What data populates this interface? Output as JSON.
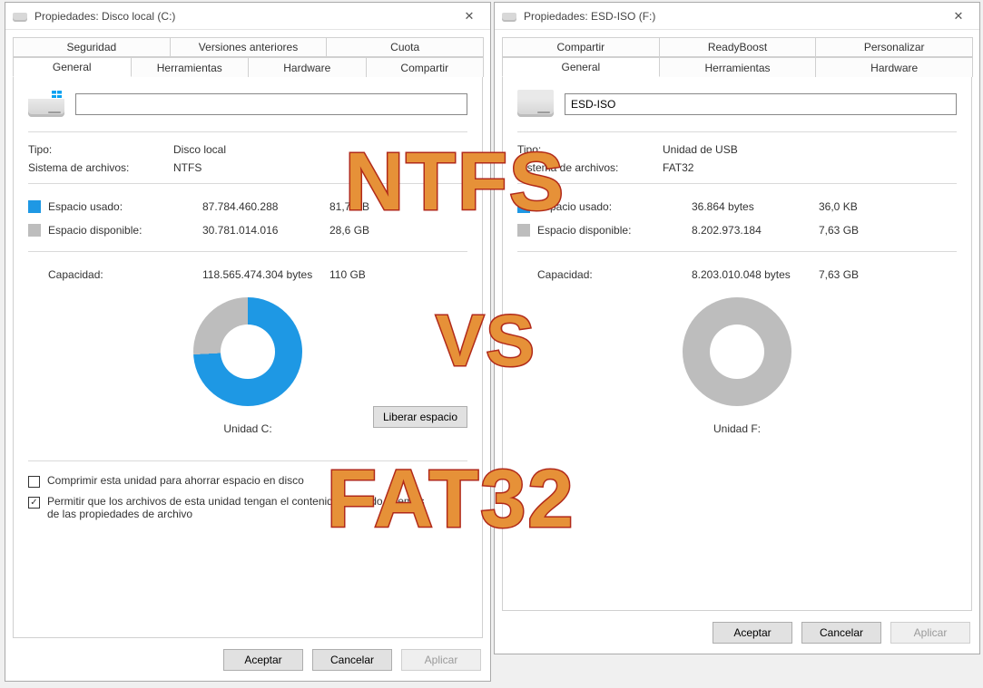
{
  "overlay": {
    "top": "NTFS",
    "mid": "VS",
    "bot": "FAT32"
  },
  "left": {
    "title": "Propiedades: Disco local (C:)",
    "tabs_row1": [
      "Seguridad",
      "Versiones anteriores",
      "Cuota"
    ],
    "tabs_row2": [
      "General",
      "Herramientas",
      "Hardware",
      "Compartir"
    ],
    "active_tab": "General",
    "drive_name_value": "",
    "type_label": "Tipo:",
    "type_value": "Disco local",
    "fs_label": "Sistema de archivos:",
    "fs_value": "NTFS",
    "used_label": "Espacio usado:",
    "used_bytes": "87.784.460.288",
    "used_human": "81,7 GB",
    "free_label": "Espacio disponible:",
    "free_bytes": "30.781.014.016",
    "free_human": "28,6 GB",
    "capacity_label": "Capacidad:",
    "capacity_bytes": "118.565.474.304 bytes",
    "capacity_human": "110 GB",
    "drive_label": "Unidad C:",
    "free_space_btn": "Liberar espacio",
    "compress_label": "Comprimir esta unidad para ahorrar espacio en disco",
    "compress_checked": false,
    "index_label": "Permitir que los archivos de esta unidad tengan el contenido indizado además de las propiedades de archivo",
    "index_checked": true,
    "used_deg": 267,
    "colors": {
      "used": "#1e98e4",
      "free": "#bdbdbd"
    }
  },
  "right": {
    "title": "Propiedades: ESD-ISO (F:)",
    "tabs_row1": [
      "Compartir",
      "ReadyBoost",
      "Personalizar"
    ],
    "tabs_row2": [
      "General",
      "Herramientas",
      "Hardware"
    ],
    "active_tab": "General",
    "drive_name_value": "ESD-ISO",
    "type_label": "Tipo:",
    "type_value": "Unidad de USB",
    "fs_label": "Sistema de archivos:",
    "fs_value": "FAT32",
    "used_label": "Espacio usado:",
    "used_bytes": "36.864 bytes",
    "used_human": "36,0 KB",
    "free_label": "Espacio disponible:",
    "free_bytes": "8.202.973.184",
    "free_human": "7,63 GB",
    "capacity_label": "Capacidad:",
    "capacity_bytes": "8.203.010.048 bytes",
    "capacity_human": "7,63 GB",
    "drive_label": "Unidad F:",
    "used_deg": 0,
    "colors": {
      "used": "#1e98e4",
      "free": "#bdbdbd"
    }
  },
  "buttons": {
    "ok": "Aceptar",
    "cancel": "Cancelar",
    "apply": "Aplicar"
  }
}
